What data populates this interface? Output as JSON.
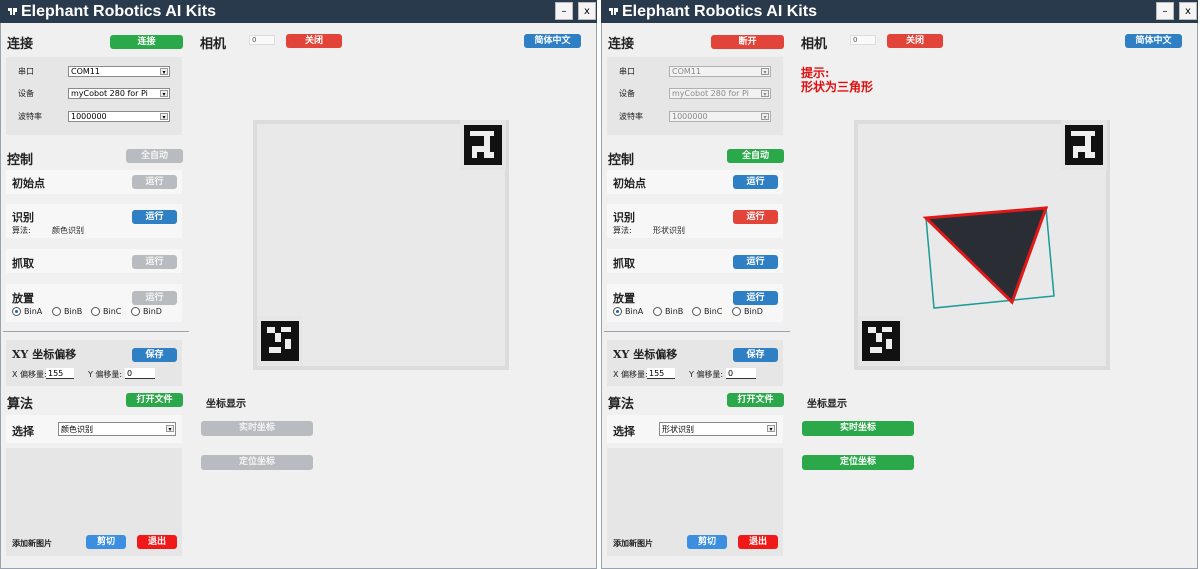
{
  "app": {
    "title": "Elephant Robotics AI Kits",
    "minimize_label": "–",
    "close_label": "x"
  },
  "colors": {
    "titlebar": "#2a3a4d",
    "green": "#2aa84a",
    "red": "#e2443a",
    "blue": "#2f7fc4"
  },
  "left_window": {
    "connection": {
      "heading": "连接",
      "connect_button": "连接",
      "serial_label": "串口",
      "serial_value": "COM11",
      "device_label": "设备",
      "device_value": "myCobot 280 for Pi",
      "baud_label": "波特率",
      "baud_value": "1000000"
    },
    "control": {
      "heading": "控制",
      "auto_button": "全自动",
      "init_label": "初始点",
      "init_run": "运行",
      "recognize_label": "识别",
      "recognize_run": "运行",
      "algorithm_label": "算法:",
      "algorithm_value": "颜色识别",
      "grab_label": "抓取",
      "grab_run": "运行",
      "place_label": "放置",
      "place_run": "运行",
      "bins": [
        "BinA",
        "BinB",
        "BinC",
        "BinD"
      ],
      "selected_bin": "BinA"
    },
    "offset": {
      "heading": "XY 坐标偏移",
      "save_button": "保存",
      "x_label": "X 偏移量:",
      "x_value": "155",
      "y_label": "Y 偏移量:",
      "y_value": "0"
    },
    "algorithm": {
      "heading": "算法",
      "open_file_button": "打开文件",
      "select_label": "选择",
      "select_value": "颜色识别",
      "add_image_label": "添加新图片",
      "cut_button": "剪切",
      "exit_button": "退出"
    },
    "camera": {
      "heading": "相机",
      "toggle_value": "0",
      "close_button": "关闭",
      "language_button": "简体中文"
    },
    "coords": {
      "heading": "坐标显示",
      "realtime_button": "实时坐标",
      "locate_button": "定位坐标"
    }
  },
  "right_window": {
    "connection": {
      "heading": "连接",
      "disconnect_button": "断开",
      "serial_label": "串口",
      "serial_value": "COM11",
      "device_label": "设备",
      "device_value": "myCobot 280 for Pi",
      "baud_label": "波特率",
      "baud_value": "1000000"
    },
    "control": {
      "heading": "控制",
      "auto_button": "全自动",
      "init_label": "初始点",
      "init_run": "运行",
      "recognize_label": "识别",
      "recognize_run": "运行",
      "algorithm_label": "算法:",
      "algorithm_value": "形状识别",
      "grab_label": "抓取",
      "grab_run": "运行",
      "place_label": "放置",
      "place_run": "运行",
      "bins": [
        "BinA",
        "BinB",
        "BinC",
        "BinD"
      ],
      "selected_bin": "BinA"
    },
    "offset": {
      "heading": "XY 坐标偏移",
      "save_button": "保存",
      "x_label": "X 偏移量:",
      "x_value": "155",
      "y_label": "Y 偏移量:",
      "y_value": "0"
    },
    "algorithm": {
      "heading": "算法",
      "open_file_button": "打开文件",
      "select_label": "选择",
      "select_value": "形状识别",
      "add_image_label": "添加新图片",
      "cut_button": "剪切",
      "exit_button": "退出"
    },
    "camera": {
      "heading": "相机",
      "toggle_value": "0",
      "close_button": "关闭",
      "language_button": "简体中文",
      "hint_title": "提示:",
      "hint_text": "形状为三角形"
    },
    "coords": {
      "heading": "坐标显示",
      "realtime_button": "实时坐标",
      "locate_button": "定位坐标"
    }
  }
}
